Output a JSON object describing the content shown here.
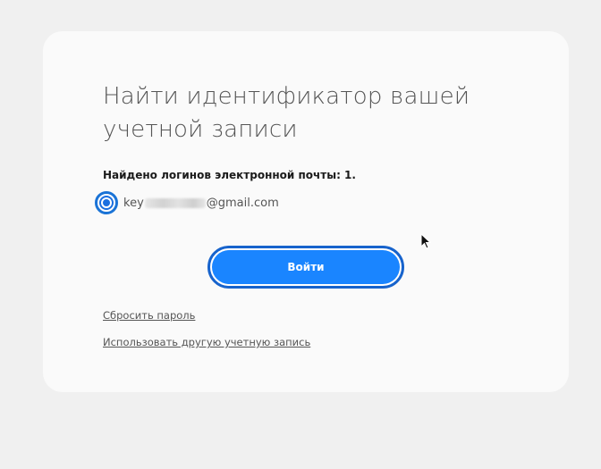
{
  "card": {
    "title": "Найти идентификатор вашей учетной записи",
    "found_label": "Найдено логинов электронной почты: 1.",
    "account": {
      "email_prefix": "key",
      "email_suffix": "@gmail.com",
      "selected": true
    },
    "login_button_label": "Войти",
    "reset_password_link": "Сбросить пароль",
    "use_other_account_link": "Использовать другую учетную запись"
  },
  "colors": {
    "page_background": "#f0f0f0",
    "card_background": "#fafafa",
    "primary_button": "#1a85ff",
    "focus_ring": "#1763cc",
    "radio_accent": "#1a6fe0"
  },
  "icons": {
    "radio": "radio-selected-icon",
    "cursor": "mouse-pointer-icon"
  }
}
